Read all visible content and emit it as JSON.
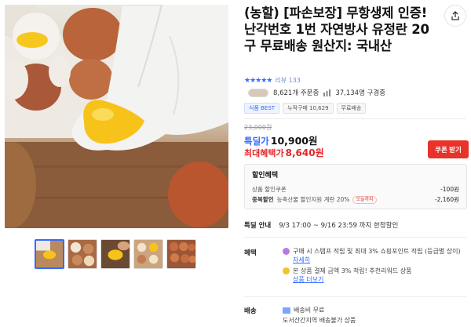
{
  "product": {
    "title": "(농할) [파손보장] 무항생제 인증! 난각번호 1번 자연방사 유정란 20구 무료배송 원산지: 국내산",
    "stars": "★★★★★",
    "review_label": "리뷰 133"
  },
  "stats": {
    "orders": "8,621개 주문중",
    "buyers": "37,134명 구경중"
  },
  "badges": [
    "식품 BEST",
    "누적구매 10,629",
    "무료배송"
  ],
  "price": {
    "original": "23,000원",
    "sale_label": "특딜가",
    "sale_price": "10,900원",
    "max_benefit_label": "최대혜택가",
    "max_benefit_price": "8,640원",
    "coupon_button": "쿠폰 받기"
  },
  "discount": {
    "title": "할인혜택",
    "lines": [
      {
        "label": "상품 할인쿠폰",
        "desc": "",
        "tag": "",
        "amount": "-100원"
      },
      {
        "label": "중복할인",
        "desc": "농축산물 할인지원 계란 20%",
        "tag": "오늘까지",
        "amount": "-2,160원"
      }
    ]
  },
  "special": {
    "label": "특딜 안내",
    "text": "9/3 17:00 ~ 9/16 23:59 까지 한정할인"
  },
  "benefits": {
    "label": "혜택",
    "item1_text": "구매 시 스탬프 적립 및 최대 3% 쇼핑포인트 적립 (등급별 상이)",
    "item1_link": "자세히",
    "item2_text": "본 상품 결제 금액 3% 적립! 추천리워드 상품",
    "item2_link": "상품 더보기"
  },
  "shipping": {
    "label": "배송",
    "fee": "배송비 무료",
    "note": "도서산간지역 배송불가 상품"
  },
  "colors": {
    "accent_blue": "#346aff",
    "red": "#e8322a",
    "yolk": "#f7c21a"
  }
}
